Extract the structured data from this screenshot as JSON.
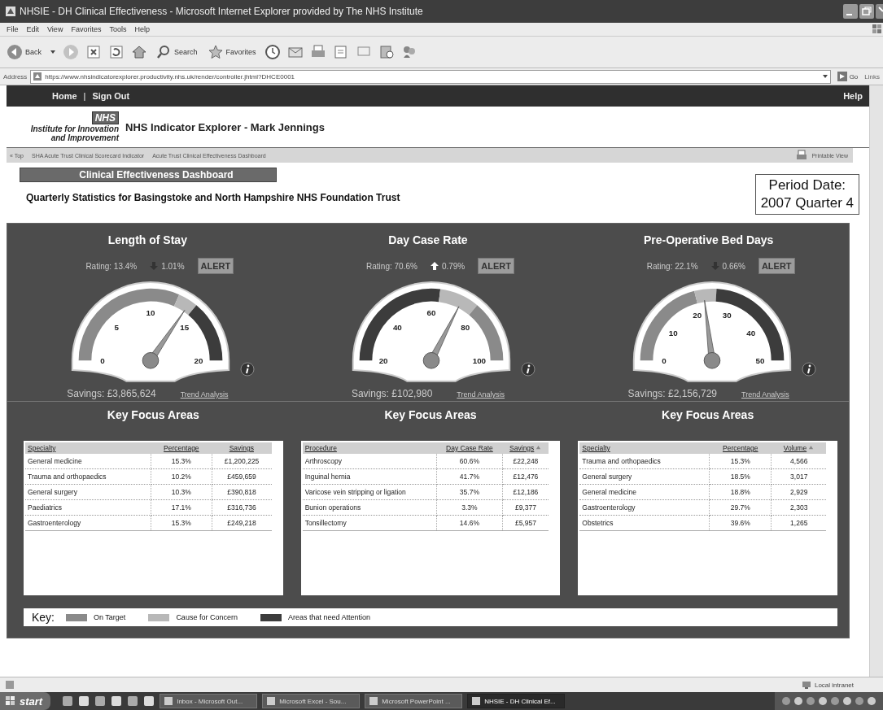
{
  "window": {
    "title": "NHSIE - DH Clinical Effectiveness - Microsoft Internet Explorer provided by The NHS Institute"
  },
  "menu": [
    "File",
    "Edit",
    "View",
    "Favorites",
    "Tools",
    "Help"
  ],
  "toolbar": {
    "back": "Back",
    "search": "Search",
    "favorites": "Favorites"
  },
  "address_bar": {
    "label": "Address",
    "url": "https://www.nhsindicatorexplorer.productivity.nhs.uk/render/controller.jhtml?DHCE0001",
    "go": "Go",
    "links": "Links"
  },
  "nav": {
    "links": [
      "Home",
      "Sign Out"
    ],
    "separator": "|",
    "help": "Help"
  },
  "header": {
    "logo": "NHS",
    "org": [
      "Institute for Innovation",
      "and Improvement"
    ],
    "title": "NHS Indicator Explorer - Mark Jennings"
  },
  "breadcrumb": {
    "items": [
      "« Top",
      "SHA Acute Trust Clinical Scorecard Indicator",
      "Acute Trust Clinical Effectiveness Dashboard"
    ],
    "printable": "Printable View"
  },
  "dashboard": {
    "title": "Clinical Effectiveness Dashboard",
    "subtitle": "Quarterly Statistics for Basingstoke and North Hampshire NHS Foundation Trust",
    "period_label": "Period Date:",
    "period": "2007 Quarter 4"
  },
  "gauges": [
    {
      "title": "Length of Stay",
      "rating": "Rating: 13.4%",
      "rising": false,
      "change": "1.01%",
      "alert": "ALERT",
      "ticks": [
        "0",
        "5",
        "10",
        "15",
        "20"
      ],
      "bands": [
        {
          "color": "#8a8a8a"
        },
        {
          "color": "#b8b8b8"
        },
        {
          "color": "#3c3c3c"
        }
      ],
      "savings": "Savings: £3,865,624",
      "link": "Trend Analysis"
    },
    {
      "title": "Day Case Rate",
      "rating": "Rating: 70.6%",
      "rising": true,
      "change": "0.79%",
      "alert": "ALERT",
      "ticks": [
        "20",
        "40",
        "60",
        "80",
        "100"
      ],
      "bands": [
        {
          "color": "#3c3c3c"
        },
        {
          "color": "#b8b8b8"
        },
        {
          "color": "#8a8a8a"
        }
      ],
      "savings": "Savings: £102,980",
      "link": "Trend Analysis"
    },
    {
      "title": "Pre-Operative Bed Days",
      "rating": "Rating: 22.1%",
      "rising": false,
      "change": "0.66%",
      "alert": "ALERT",
      "ticks": [
        "0",
        "10",
        "20",
        "30",
        "40",
        "50"
      ],
      "bands": [
        {
          "color": "#8a8a8a"
        },
        {
          "color": "#b8b8b8"
        },
        {
          "color": "#3c3c3c"
        }
      ],
      "savings": "Savings: £2,156,729",
      "link": "Trend Analysis"
    }
  ],
  "focus_areas": [
    {
      "title": "Key Focus Areas",
      "columns": [
        {
          "label": "Specialty",
          "sorted": false
        },
        {
          "label": "Percentage",
          "sorted": false
        },
        {
          "label": "Savings",
          "sorted": false
        }
      ],
      "rows": [
        [
          "General medicine",
          "15.3%",
          "£1,200,225"
        ],
        [
          "Trauma and orthopaedics",
          "10.2%",
          "£459,659"
        ],
        [
          "General surgery",
          "10.3%",
          "£390,818"
        ],
        [
          "Paediatrics",
          "17.1%",
          "£316,736"
        ],
        [
          "Gastroenterology",
          "15.3%",
          "£249,218"
        ]
      ]
    },
    {
      "title": "Key Focus Areas",
      "columns": [
        {
          "label": "Procedure",
          "sorted": false
        },
        {
          "label": "Day Case Rate",
          "sorted": false
        },
        {
          "label": "Savings",
          "sorted": true
        }
      ],
      "rows": [
        [
          "Arthroscopy",
          "60.6%",
          "£22,248"
        ],
        [
          "Inguinal hernia",
          "41.7%",
          "£12,476"
        ],
        [
          "Varicose vein stripping or ligation",
          "35.7%",
          "£12,186"
        ],
        [
          "Bunion operations",
          "3.3%",
          "£9,377"
        ],
        [
          "Tonsillectomy",
          "14.6%",
          "£5,957"
        ]
      ]
    },
    {
      "title": "Key Focus Areas",
      "columns": [
        {
          "label": "Specialty",
          "sorted": false
        },
        {
          "label": "Percentage",
          "sorted": false
        },
        {
          "label": "Volume",
          "sorted": true
        }
      ],
      "rows": [
        [
          "Trauma and orthopaedics",
          "15.3%",
          "4,566"
        ],
        [
          "General surgery",
          "18.5%",
          "3,017"
        ],
        [
          "General medicine",
          "18.8%",
          "2,929"
        ],
        [
          "Gastroenterology",
          "29.7%",
          "2,303"
        ],
        [
          "Obstetrics",
          "39.6%",
          "1,265"
        ]
      ]
    }
  ],
  "key": {
    "label": "Key:",
    "items": [
      {
        "label": "On Target",
        "color": "#8a8a8a"
      },
      {
        "label": "Cause for Concern",
        "color": "#b8b8b8"
      },
      {
        "label": "Areas that need Attention",
        "color": "#3c3c3c"
      }
    ]
  },
  "status_bar": {
    "zone": "Local intranet"
  },
  "taskbar": {
    "start": "start",
    "tasks": [
      {
        "label": "Inbox - Microsoft Out...",
        "selected": false
      },
      {
        "label": "Microsoft Excel - Sou...",
        "selected": false
      },
      {
        "label": "Microsoft PowerPoint ...",
        "selected": false
      },
      {
        "label": "NHSIE - DH Clinical Ef...",
        "selected": true
      }
    ]
  }
}
